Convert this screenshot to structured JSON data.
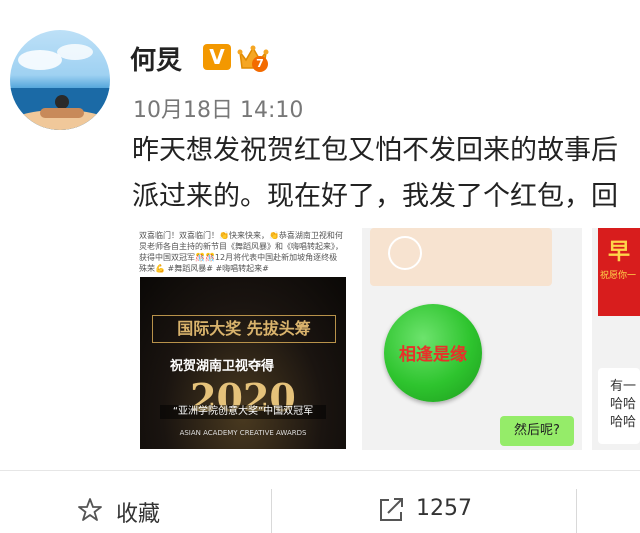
{
  "user": {
    "name": "何炅",
    "verified_badge": "V",
    "level": "7",
    "time": "10月18日 14:10"
  },
  "post": {
    "line1": "昨天想发祝贺红包又怕不发回来的故事后",
    "line2": "派过来的。现在好了，我发了个红包，回"
  },
  "images": {
    "img1": {
      "top_text": "双喜临门！双喜临门！👏快来快来，👏恭喜湖南卫视和何炅老师各自主持的新节目《舞蹈风暴》和《嗨唱转起来》，获得中国双冠军🎊🎊12月将代表中国赴新加坡角逐终极殊荣💪 #舞蹈风暴# #嗨唱转起来#",
      "poster_title": "国际大奖 先拔头筹",
      "poster_sub": "祝贺湖南卫视夺得",
      "poster_year": "2020",
      "poster_award": "“亚洲学院创意大奖”中国双冠军",
      "poster_en": "ASIAN ACADEMY CREATIVE AWARDS"
    },
    "img2": {
      "button_text": "相逢是缘",
      "bubble_text": "然后呢?"
    },
    "img3": {
      "red_text": "早",
      "red_sub": "祝愿你一",
      "bubble_text": "有一\n哈哈\n哈哈"
    }
  },
  "actions": {
    "favorite_label": "收藏",
    "share_count": "1257"
  },
  "colors": {
    "vip_orange": "#f39800",
    "green_button": "#2ec42e",
    "chat_green": "#95ec69"
  }
}
